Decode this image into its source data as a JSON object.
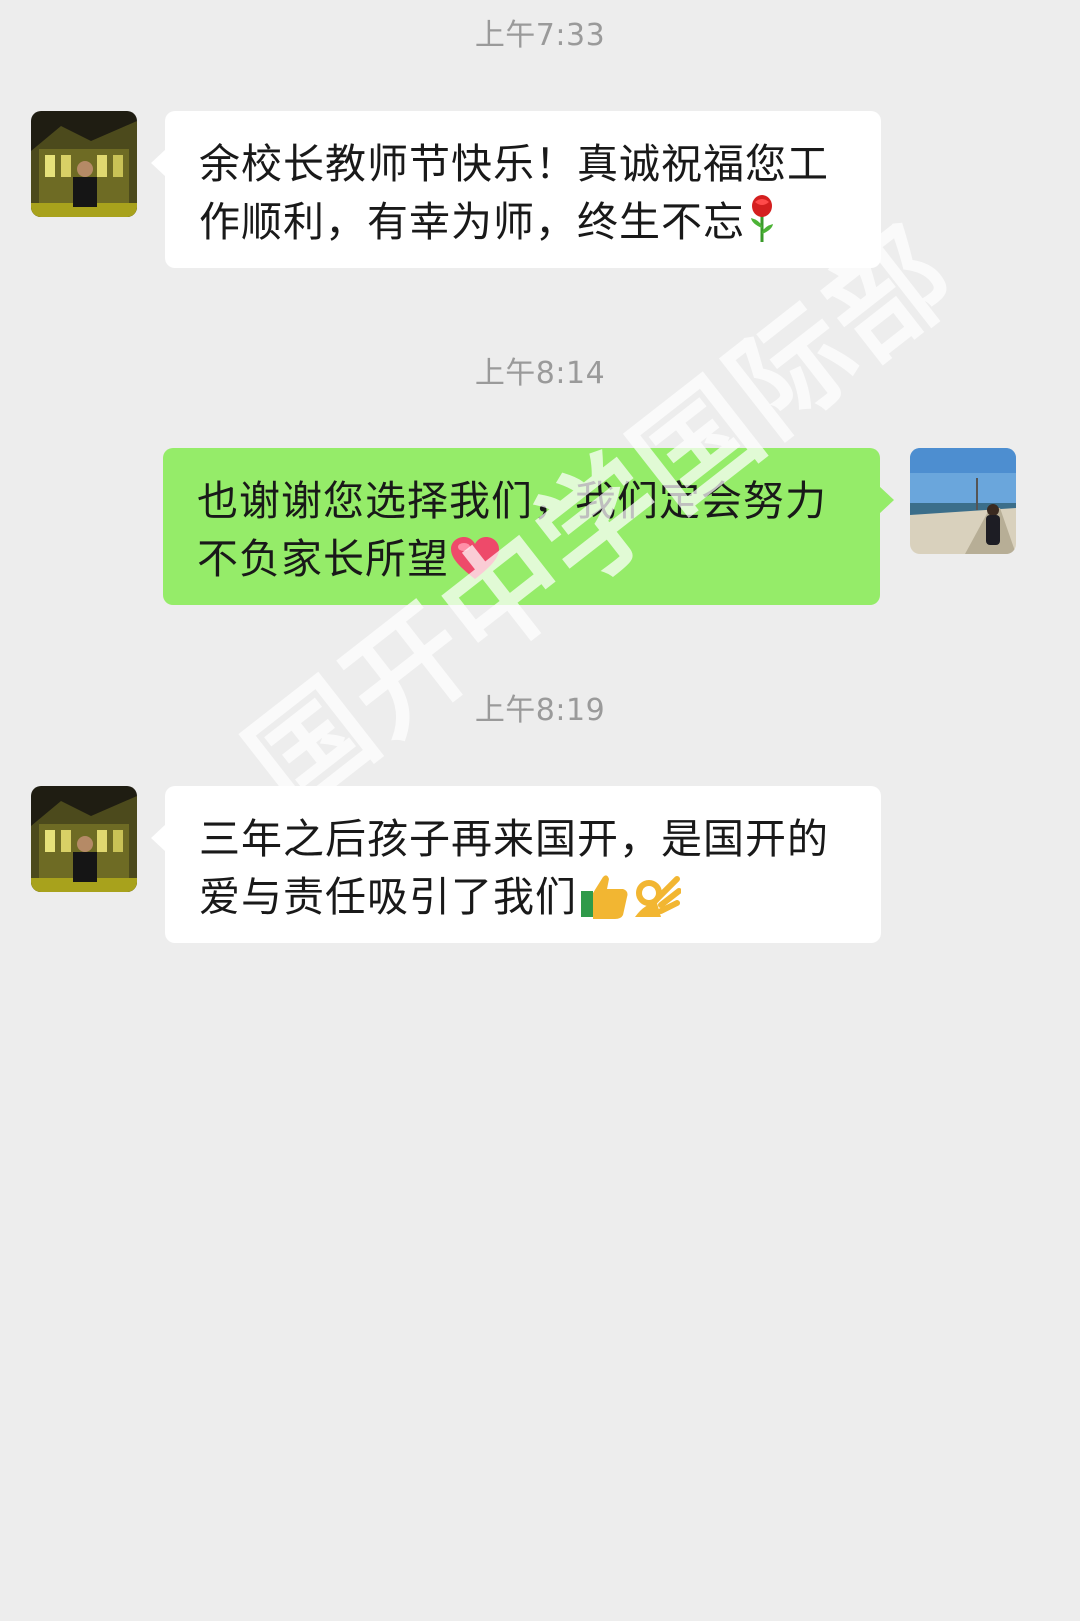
{
  "messages": [
    {
      "timestamp": "上午7:33",
      "direction": "incoming",
      "avatar": "avatar-man-night-building",
      "lines": [
        "余校长教师节快乐！真诚祝福您工",
        "作顺利，有幸为师，终生不忘"
      ],
      "emoji": "rose-emoji"
    },
    {
      "timestamp": "上午8:14",
      "direction": "outgoing",
      "avatar": "avatar-woman-beach",
      "lines": [
        "也谢谢您选择我们，我们定会努力",
        "不负家长所望"
      ],
      "emoji": "heart-emoji"
    },
    {
      "timestamp": "上午8:19",
      "direction": "incoming",
      "avatar": "avatar-man-night-building",
      "lines": [
        "三年之后孩子再来国开，是国开的",
        "爱与责任吸引了我们"
      ],
      "emoji": "thumbs-up-and-ok-emoji"
    }
  ],
  "watermark": "国开中学国际部",
  "colors": {
    "background": "#ededed",
    "incoming_bubble": "#ffffff",
    "outgoing_bubble": "#95ec69",
    "timestamp_text": "#9a9a9a"
  }
}
